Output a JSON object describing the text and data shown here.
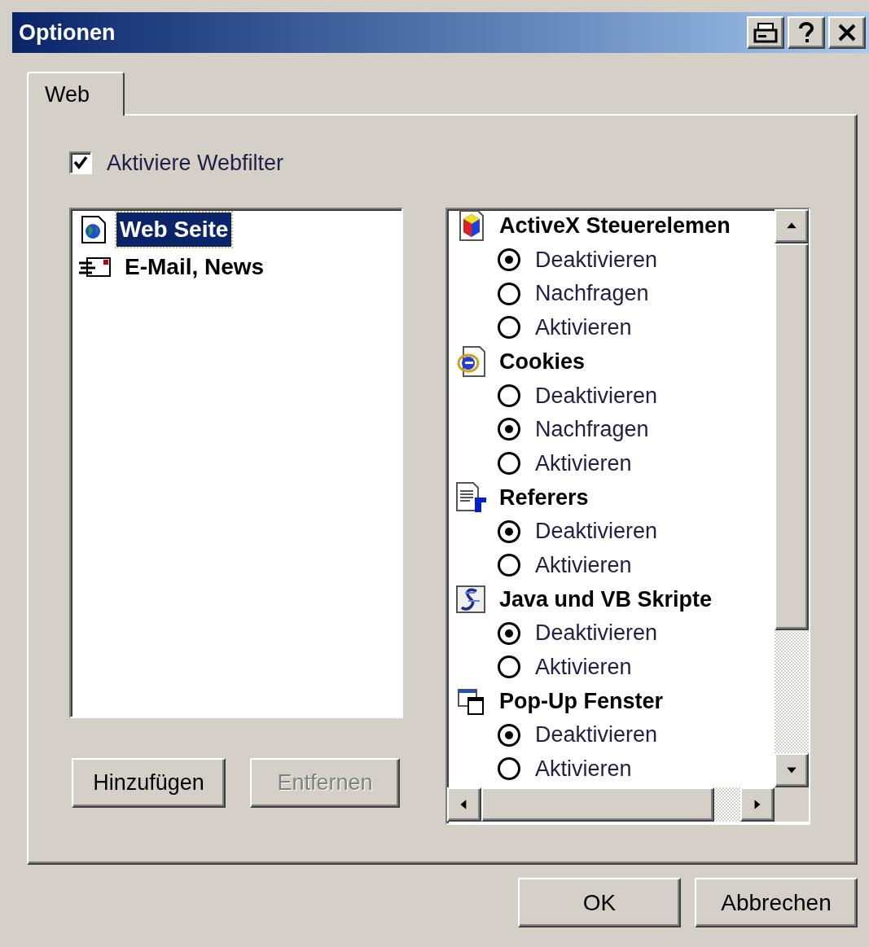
{
  "window": {
    "title": "Optionen"
  },
  "tabs": [
    {
      "label": "Web",
      "selected": true
    }
  ],
  "filter_checkbox": {
    "label": "Aktiviere Webfilter",
    "checked": true
  },
  "categories": [
    {
      "label": "Web Seite",
      "selected": true
    },
    {
      "label": "E-Mail, News",
      "selected": false
    }
  ],
  "list_buttons": [
    {
      "label": "Hinzufügen",
      "disabled": false
    },
    {
      "label": "Entfernen",
      "disabled": true
    }
  ],
  "settings": [
    {
      "label": "ActiveX Steuerelemen",
      "options": [
        {
          "label": "Deaktivieren",
          "selected": true
        },
        {
          "label": "Nachfragen",
          "selected": false
        },
        {
          "label": "Aktivieren",
          "selected": false
        }
      ]
    },
    {
      "label": "Cookies",
      "options": [
        {
          "label": "Deaktivieren",
          "selected": false
        },
        {
          "label": "Nachfragen",
          "selected": true
        },
        {
          "label": "Aktivieren",
          "selected": false
        }
      ]
    },
    {
      "label": "Referers",
      "options": [
        {
          "label": "Deaktivieren",
          "selected": true
        },
        {
          "label": "Aktivieren",
          "selected": false
        }
      ]
    },
    {
      "label": "Java und VB Skripte",
      "options": [
        {
          "label": "Deaktivieren",
          "selected": true
        },
        {
          "label": "Aktivieren",
          "selected": false
        }
      ]
    },
    {
      "label": "Pop-Up Fenster",
      "options": [
        {
          "label": "Deaktivieren",
          "selected": true
        },
        {
          "label": "Aktivieren",
          "selected": false
        }
      ]
    }
  ],
  "dialog_buttons": [
    {
      "label": "OK"
    },
    {
      "label": "Abbrechen"
    }
  ]
}
